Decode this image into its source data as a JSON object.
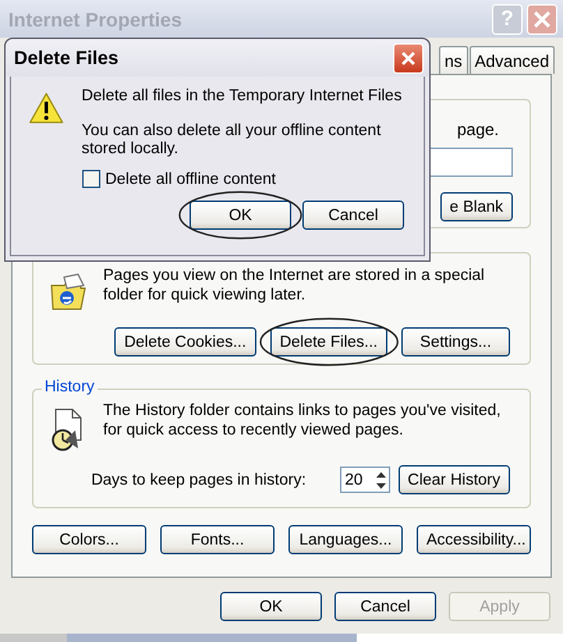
{
  "window": {
    "title": "Internet Properties",
    "help_button": "?"
  },
  "tabs": [
    {
      "label": "ns",
      "selected": false
    },
    {
      "label": "Advanced",
      "selected": false
    }
  ],
  "home_page": {
    "text": "page.",
    "button": "e Blank"
  },
  "temporary_files": {
    "text": "Pages you view on the Internet are stored in a special folder for quick viewing later.",
    "buttons": [
      {
        "label": "Delete Cookies...",
        "circled": false
      },
      {
        "label": "Delete Files...",
        "circled": true
      },
      {
        "label": "Settings...",
        "circled": false
      }
    ]
  },
  "history": {
    "title": "History",
    "text": "The History folder contains links to pages you've visited, for quick access to recently viewed pages.",
    "days_label": "Days to keep pages in history:",
    "days": "20",
    "button": "Clear History"
  },
  "bottom_buttons": [
    "Colors...",
    "Fonts...",
    "Languages...",
    "Accessibility..."
  ],
  "dialog_buttons": [
    {
      "label": "OK",
      "disabled": false
    },
    {
      "label": "Cancel",
      "disabled": false
    },
    {
      "label": "Apply",
      "disabled": true
    }
  ],
  "delete_dialog": {
    "title": "Delete Files",
    "message": "Delete all files in the Temporary Internet Files",
    "note": "You can also delete all your offline content stored locally.",
    "checkbox": {
      "label": "Delete all offline content",
      "checked": false
    },
    "buttons": [
      {
        "label": "OK",
        "circled": true
      },
      {
        "label": "Cancel",
        "circled": false
      }
    ]
  }
}
